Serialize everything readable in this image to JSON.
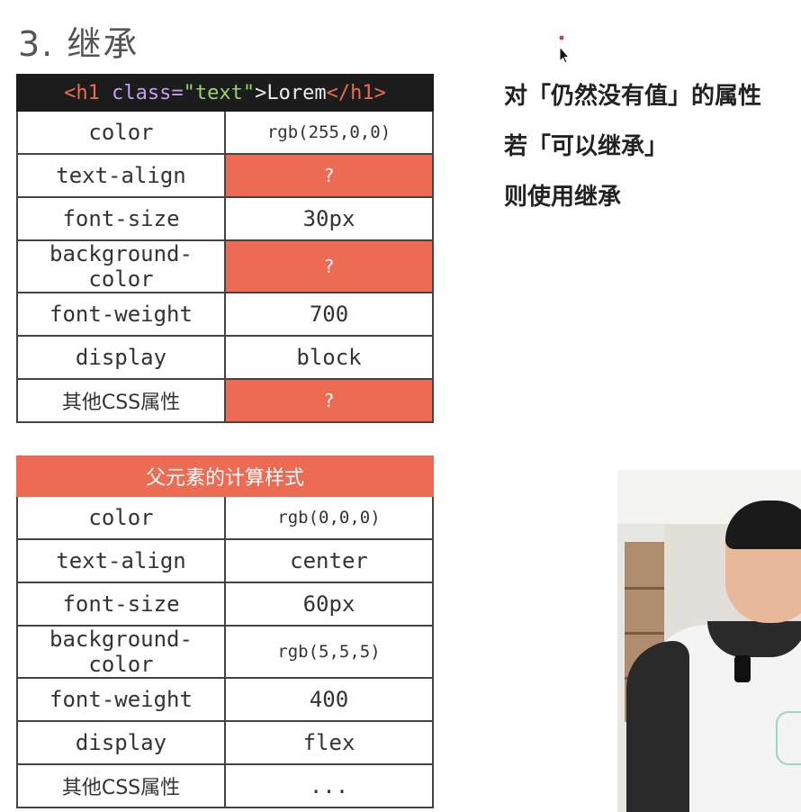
{
  "slide": {
    "title": "3. 继承"
  },
  "element_table": {
    "header": {
      "tag_open": "<h1",
      "attr": " class=",
      "attr_value": "\"text\"",
      "tag_close": ">",
      "text": "Lorem",
      "end_tag": "</h1>"
    },
    "rows": [
      {
        "property": "color",
        "value": "rgb(255,0,0)"
      },
      {
        "property": "text-align",
        "value": "?"
      },
      {
        "property": "font-size",
        "value": "30px"
      },
      {
        "property": "background-color",
        "value": "?"
      },
      {
        "property": "font-weight",
        "value": "700"
      },
      {
        "property": "display",
        "value": "block"
      },
      {
        "property": "其他CSS属性",
        "value": "?"
      }
    ]
  },
  "parent_table": {
    "header": "父元素的计算样式",
    "rows": [
      {
        "property": "color",
        "value": "rgb(0,0,0)"
      },
      {
        "property": "text-align",
        "value": "center"
      },
      {
        "property": "font-size",
        "value": "60px"
      },
      {
        "property": "background-color",
        "value": "rgb(5,5,5)"
      },
      {
        "property": "font-weight",
        "value": "400"
      },
      {
        "property": "display",
        "value": "flex"
      },
      {
        "property": "其他CSS属性",
        "value": "..."
      }
    ]
  },
  "notes": {
    "line1": "对「仍然没有值」的属性",
    "line2": "若「可以继承」",
    "line3": "则使用继承"
  },
  "colors": {
    "accent": "#ec6b52",
    "code_background": "#1c1c1c",
    "text": "#333333"
  },
  "icons": {
    "cursor": "arrow-cursor-icon"
  }
}
